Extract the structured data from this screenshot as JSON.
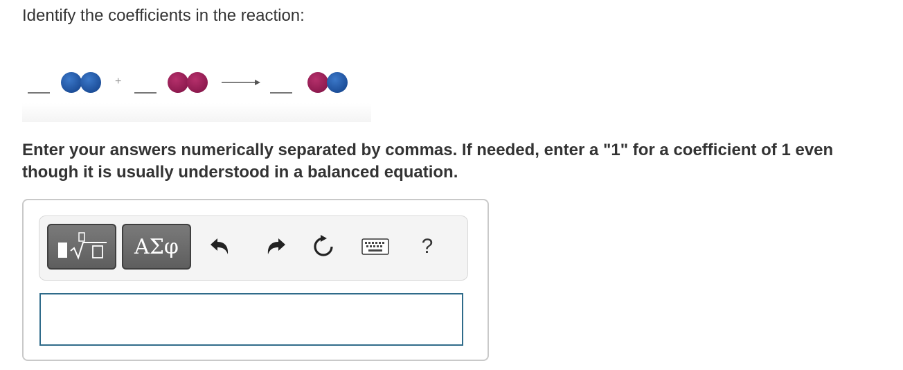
{
  "question": {
    "prompt": "Identify the coefficients in the reaction:"
  },
  "reaction": {
    "reactant_1": {
      "atoms": [
        "blue",
        "blue"
      ]
    },
    "plus_symbol": "+",
    "reactant_2": {
      "atoms": [
        "magenta",
        "magenta"
      ]
    },
    "product": {
      "atoms": [
        "magenta",
        "blue"
      ]
    },
    "colors": {
      "blue": "#2a62b0",
      "magenta": "#a0245c"
    }
  },
  "instructions": {
    "text": "Enter your answers numerically separated by commas. If needed, enter a \"1\" for a coefficient of 1 even though it is usually understood in a balanced equation."
  },
  "toolbar": {
    "templates_icon": "templates-sqrt-icon",
    "greek_label": "ΑΣφ",
    "undo_icon": "undo-icon",
    "redo_icon": "redo-icon",
    "reset_icon": "reset-icon",
    "keyboard_icon": "keyboard-icon",
    "help_label": "?"
  },
  "answer": {
    "value": "",
    "placeholder": ""
  }
}
